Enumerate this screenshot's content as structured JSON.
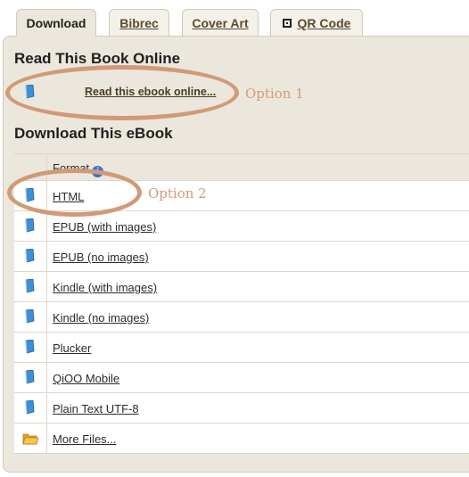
{
  "tabs": [
    {
      "label": "Download",
      "active": true
    },
    {
      "label": "Bibrec",
      "active": false
    },
    {
      "label": "Cover Art",
      "active": false
    },
    {
      "label": "QR Code",
      "active": false,
      "icon": "qr-code-icon"
    }
  ],
  "read_online": {
    "heading": "Read This Book Online",
    "link_label": "Read this ebook online...",
    "icon": "book-icon"
  },
  "download": {
    "heading": "Download This eBook",
    "column_header": "Format",
    "header_icon": "info-icon",
    "rows": [
      {
        "label": "HTML",
        "icon": "book-icon"
      },
      {
        "label": "EPUB (with images)",
        "icon": "book-icon"
      },
      {
        "label": "EPUB (no images)",
        "icon": "book-icon"
      },
      {
        "label": "Kindle (with images)",
        "icon": "book-icon"
      },
      {
        "label": "Kindle (no images)",
        "icon": "book-icon"
      },
      {
        "label": "Plucker",
        "icon": "book-icon"
      },
      {
        "label": "QiOO Mobile",
        "icon": "book-icon"
      },
      {
        "label": "Plain Text UTF-8",
        "icon": "book-icon"
      },
      {
        "label": "More Files...",
        "icon": "folder-icon"
      }
    ]
  },
  "annotations": {
    "option1": "Option 1",
    "option2": "Option 2",
    "color": "#d19a77"
  },
  "colors": {
    "panel_bg": "#ebe7dc",
    "link_color": "#4a3d24",
    "book_icon_blue": "#3d8fd8",
    "folder_yellow": "#f0b632"
  }
}
